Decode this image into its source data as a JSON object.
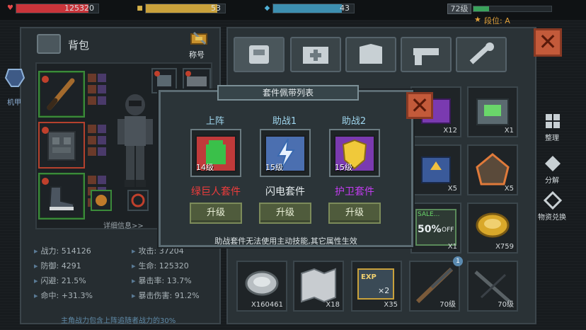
{
  "topbar": {
    "hp_value": "125320",
    "gold_value": "53",
    "energy_value": "43",
    "player_level": "72级",
    "rank_label": "段位: A",
    "colors": {
      "hp": "#c9343a",
      "gold": "#c9a13b",
      "energy": "#3d8fb0",
      "xp": "#3aa35c"
    },
    "hp_fill_fraction": 0.88,
    "gold_fill_fraction": 0.9,
    "energy_fill_fraction": 0.85,
    "xp_fill_fraction": 0.2
  },
  "left_panel": {
    "title": "背包",
    "title_badge": "称号",
    "mech_label": "机甲",
    "details_link": "详细信息>>",
    "stats_left": [
      {
        "label": "战力:",
        "value": "514126"
      },
      {
        "label": "防御:",
        "value": "4291"
      },
      {
        "label": "闪避:",
        "value": "21.5%"
      },
      {
        "label": "命中:",
        "value": "+31.3%"
      }
    ],
    "stats_right": [
      {
        "label": "攻击:",
        "value": "37204"
      },
      {
        "label": "生命:",
        "value": "125320"
      },
      {
        "label": "暴击率:",
        "value": "13.7%"
      },
      {
        "label": "暴击伤害:",
        "value": "91.2%"
      }
    ],
    "footer_note": "主角战力包含上阵追随者战力的30%"
  },
  "side_actions": [
    {
      "label": "整理",
      "icon": "grid-icon"
    },
    {
      "label": "分解",
      "icon": "decompose-icon"
    },
    {
      "label": "物资兑换",
      "icon": "exchange-icon"
    }
  ],
  "inventory": {
    "cells": [
      {
        "qty": "X12",
        "icon": "purple-box-icon"
      },
      {
        "qty": "X1",
        "icon": "green-chest-icon"
      },
      {
        "qty": "X5",
        "icon": "upgrade-box-icon"
      },
      {
        "qty": "X5",
        "icon": "orange-chest-icon"
      },
      {
        "qty": "X1",
        "icon": "sale-card-icon"
      },
      {
        "qty": "X759",
        "icon": "gold-coin-icon"
      },
      {
        "qty": "X160461",
        "icon": "silver-coin-icon"
      },
      {
        "qty": "X18",
        "icon": "map-icon"
      },
      {
        "qty": "X35",
        "icon": "exp-card-icon"
      },
      {
        "qty": "70级",
        "icon": "shotgun-icon"
      },
      {
        "qty": "70级",
        "icon": "crossbow-icon"
      }
    ],
    "sale_text": "SALE...",
    "sale_percent": "50%",
    "sale_off": "OFF",
    "exp_text": "EXP",
    "exp_mult": "×2",
    "notification_badge": "1"
  },
  "modal": {
    "title": "套件佩带列表",
    "columns": [
      {
        "label": "上阵",
        "level": "14级",
        "name": "绿巨人套件",
        "name_color": "#f03c3c",
        "icon": "green-fist-icon",
        "frame": "#c03a3a"
      },
      {
        "label": "助战1",
        "level": "15级",
        "name": "闪电套件",
        "name_color": "#e6ecee",
        "icon": "lightning-icon",
        "frame": "#4b6fb0"
      },
      {
        "label": "助战2",
        "level": "15级",
        "name": "护卫套件",
        "name_color": "#c23cf0",
        "icon": "shield-icon",
        "frame": "#7a3ab0"
      }
    ],
    "upgrade_label": "升级",
    "note": "助战套件无法使用主动技能,其它属性生效"
  }
}
